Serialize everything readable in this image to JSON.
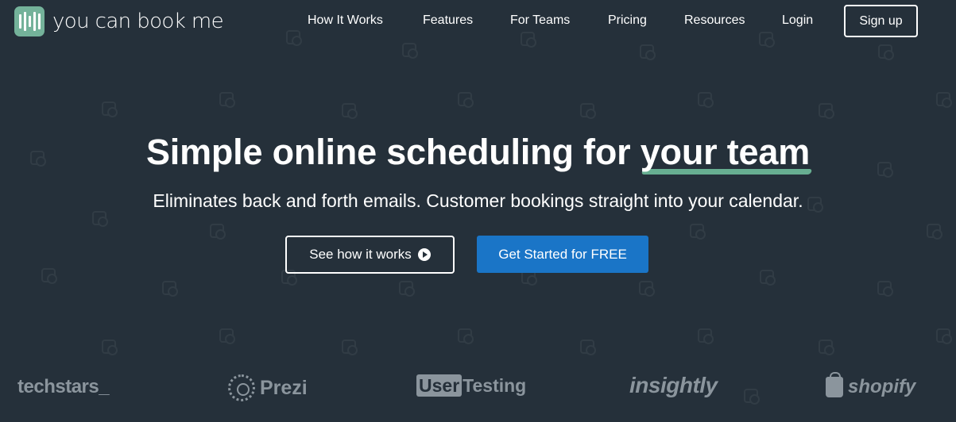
{
  "brand": {
    "name": "you can book me",
    "accent": "#74b29a"
  },
  "nav": {
    "items": [
      "How It Works",
      "Features",
      "For Teams",
      "Pricing",
      "Resources",
      "Login"
    ],
    "signup_label": "Sign up"
  },
  "hero": {
    "title_prefix": "Simple online scheduling for ",
    "title_highlight": "your team",
    "subtitle": "Eliminates back and forth emails. Customer bookings straight into your calendar.",
    "secondary_cta": "See how it works",
    "primary_cta": "Get Started for FREE"
  },
  "clients": {
    "techstars": "techstars_",
    "prezi": "Prezi",
    "usertesting_box": "User",
    "usertesting_rest": "Testing",
    "insightly": "insightly",
    "shopify": "shopify"
  },
  "colors": {
    "background": "#25303a",
    "primary_button": "#1a75c7",
    "highlight_underline": "#6ab596",
    "logo_muted": "#8b959d"
  }
}
